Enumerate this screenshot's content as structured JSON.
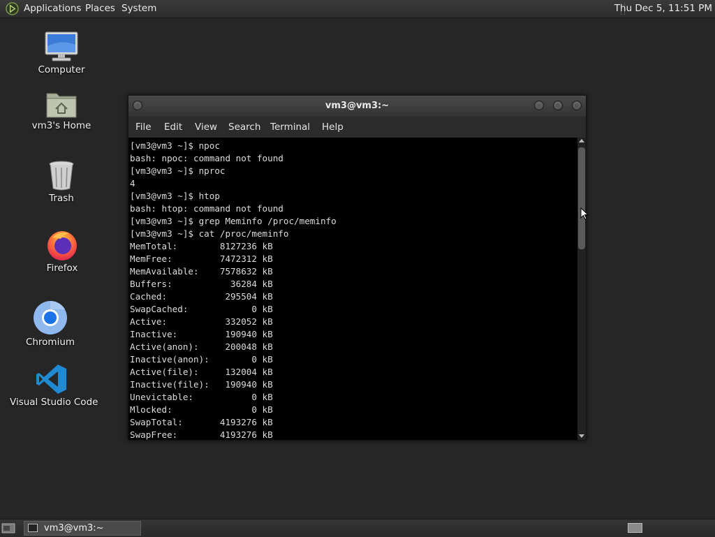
{
  "top_panel": {
    "menus": [
      "Applications",
      "Places",
      "System"
    ],
    "clock": "Thu Dec 5, 11:51 PM"
  },
  "desktop": {
    "icons": [
      {
        "label": "Computer",
        "icon": "computer-icon"
      },
      {
        "label": "vm3's Home",
        "icon": "home-folder-icon"
      },
      {
        "label": "Trash",
        "icon": "trash-icon"
      },
      {
        "label": "Firefox",
        "icon": "firefox-icon"
      },
      {
        "label": "Chromium",
        "icon": "chromium-icon"
      },
      {
        "label": "Visual Studio Code",
        "icon": "vscode-icon"
      }
    ]
  },
  "terminal": {
    "title": "vm3@vm3:~",
    "menu": [
      "File",
      "Edit",
      "View",
      "Search",
      "Terminal",
      "Help"
    ],
    "lines": [
      "[vm3@vm3 ~]$ npoc",
      "bash: npoc: command not found",
      "[vm3@vm3 ~]$ nproc",
      "4",
      "[vm3@vm3 ~]$ htop",
      "bash: htop: command not found",
      "[vm3@vm3 ~]$ grep Meminfo /proc/meminfo",
      "[vm3@vm3 ~]$ cat /proc/meminfo",
      "MemTotal:        8127236 kB",
      "MemFree:         7472312 kB",
      "MemAvailable:    7578632 kB",
      "Buffers:           36284 kB",
      "Cached:           295504 kB",
      "SwapCached:            0 kB",
      "Active:           332052 kB",
      "Inactive:         190940 kB",
      "Active(anon):     200048 kB",
      "Inactive(anon):        0 kB",
      "Active(file):     132004 kB",
      "Inactive(file):   190940 kB",
      "Unevictable:           0 kB",
      "Mlocked:               0 kB",
      "SwapTotal:       4193276 kB",
      "SwapFree:        4193276 kB"
    ]
  },
  "taskbar": {
    "task_label": "vm3@vm3:~"
  }
}
